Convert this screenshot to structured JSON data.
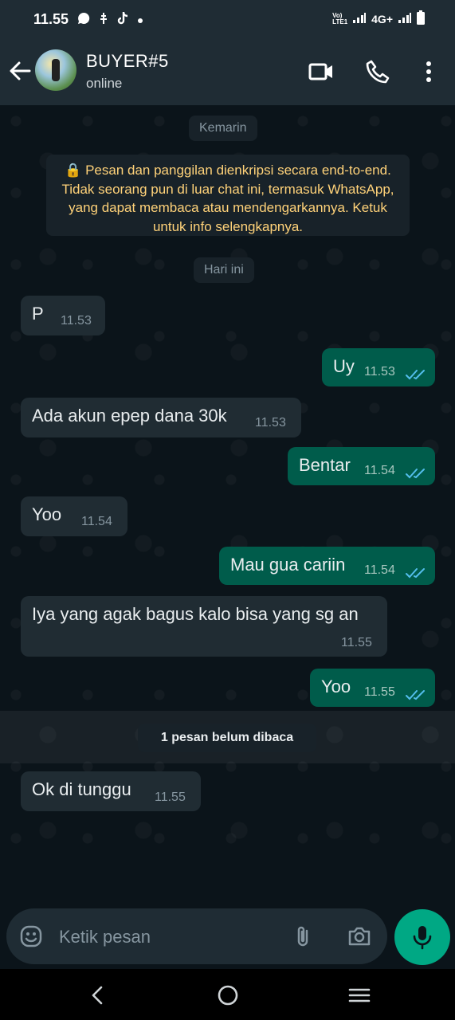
{
  "status_bar": {
    "time": "11.55",
    "network": "4G+"
  },
  "header": {
    "contact_name": "BUYER#5",
    "contact_status": "online"
  },
  "dates": {
    "yesterday": "Kemarin",
    "today": "Hari ini"
  },
  "encryption_notice": "🔒 Pesan dan panggilan dienkripsi secara end-to-end. Tidak seorang pun di luar chat ini, termasuk WhatsApp, yang dapat membaca atau mendengarkannya. Ketuk untuk info selengkapnya.",
  "messages": [
    {
      "direction": "in",
      "text": "P",
      "time": "11.53"
    },
    {
      "direction": "out",
      "text": "Uy",
      "time": "11.53",
      "status": "read"
    },
    {
      "direction": "in",
      "text": "Ada akun epep dana 30k",
      "time": "11.53"
    },
    {
      "direction": "out",
      "text": "Bentar",
      "time": "11.54",
      "status": "read"
    },
    {
      "direction": "in",
      "text": "Yoo",
      "time": "11.54"
    },
    {
      "direction": "out",
      "text": "Mau gua cariin",
      "time": "11.54",
      "status": "read"
    },
    {
      "direction": "in",
      "text": "Iya yang agak bagus kalo bisa yang sg an",
      "time": "11.55"
    },
    {
      "direction": "out",
      "text": "Yoo",
      "time": "11.55",
      "status": "read"
    },
    {
      "direction": "in",
      "text": "Ok di tunggu",
      "time": "11.55"
    }
  ],
  "unread_label": "1 pesan belum dibaca",
  "composer": {
    "placeholder": "Ketik pesan"
  },
  "colors": {
    "background": "#0b141a",
    "bar": "#1f2c34",
    "incoming_bubble": "#202c33",
    "outgoing_bubble": "#005c4b",
    "accent": "#00a884",
    "read_ticks": "#53bdeb",
    "notice_text": "#ffd279"
  },
  "icons": [
    "back-arrow-icon",
    "video-call-icon",
    "phone-icon",
    "more-vert-icon",
    "emoji-icon",
    "attach-icon",
    "camera-icon",
    "mic-icon"
  ]
}
